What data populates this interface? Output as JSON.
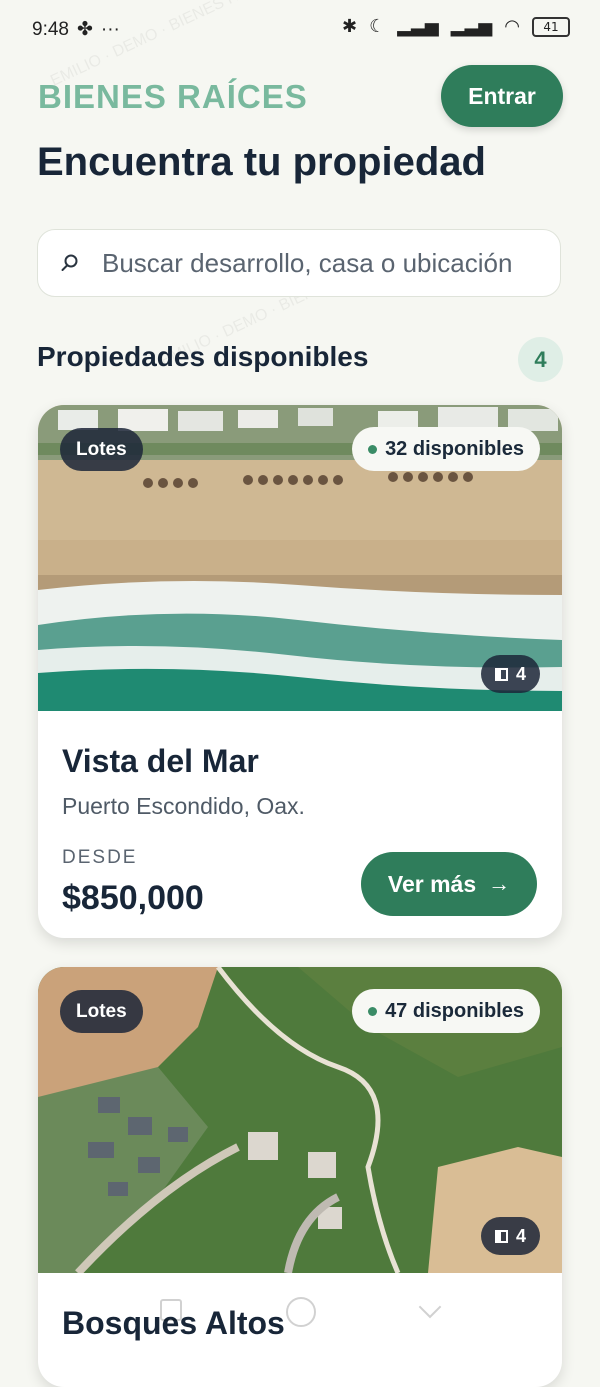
{
  "status_bar": {
    "time": "9:48",
    "battery": "41"
  },
  "header": {
    "brand": "BIENES RAÍCES",
    "login_label": "Entrar"
  },
  "page_title": "Encuentra tu propiedad",
  "search": {
    "placeholder": "Buscar desarrollo, casa o ubicación"
  },
  "section": {
    "title": "Propiedades disponibles",
    "count": "4"
  },
  "properties": [
    {
      "type": "Lotes",
      "available": "32 disponibles",
      "photos": "4",
      "name": "Vista del Mar",
      "location": "Puerto Escondido, Oax.",
      "price_label": "DESDE",
      "price": "$850,000",
      "cta": "Ver más",
      "image": "beach-aerial"
    },
    {
      "type": "Lotes",
      "available": "47 disponibles",
      "photos": "4",
      "name": "Bosques Altos",
      "image": "forest-aerial"
    }
  ],
  "colors": {
    "brand": "#79b99e",
    "primary": "#2f7d5b",
    "text": "#182638",
    "background": "#f6f7f2"
  },
  "icons": [
    "search-icon",
    "gallery-icon",
    "arrow-right-icon"
  ]
}
